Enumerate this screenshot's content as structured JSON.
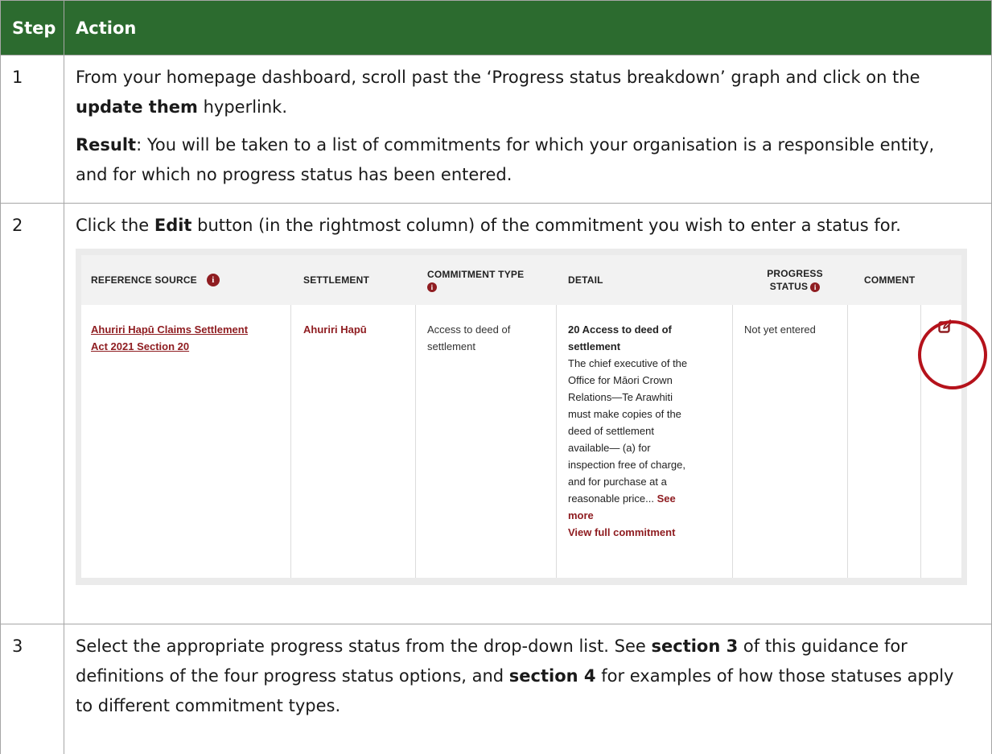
{
  "table": {
    "headers": [
      "Step",
      "Action"
    ],
    "rows": [
      {
        "step": "1",
        "p1_a": "From your homepage dashboard, scroll past the ‘Progress status breakdown’ graph and click on the ",
        "p1_b": "update them",
        "p1_c": " hyperlink.",
        "p2_a": "Result",
        "p2_b": ": You will be taken to a list of commitments for which your organisation is a responsible entity, and for which no progress status has been entered."
      },
      {
        "step": "2",
        "p1_a": "Click the ",
        "p1_b": "Edit",
        "p1_c": " button (in the rightmost column) of the commitment you wish to enter a status for."
      },
      {
        "step": "3",
        "p1_a": "Select the appropriate progress status from the drop-down list. See ",
        "p1_b": "section 3",
        "p1_c": " of this guidance for definitions of the four progress status options, and ",
        "p1_d": "section 4",
        "p1_e": " for examples of how those statuses apply to different commitment types."
      }
    ]
  },
  "screenshot": {
    "headers": {
      "reference_source": "REFERENCE SOURCE",
      "settlement": "SETTLEMENT",
      "commitment_type": "COMMITMENT TYPE",
      "detail": "DETAIL",
      "progress_status_1": "PROGRESS",
      "progress_status_2": "STATUS",
      "comment": "COMMENT"
    },
    "row": {
      "reference_link_1": "Ahuriri Hapū Claims Settlement",
      "reference_link_2": "Act 2021 Section 20",
      "settlement": "Ahuriri Hapū",
      "commitment_type_1": "Access to deed of",
      "commitment_type_2": "settlement",
      "detail_title_1": "20 Access to deed of",
      "detail_title_2": "settlement",
      "detail_body": [
        "The chief executive of the",
        "Office for Māori Crown",
        "Relations—Te Arawhiti",
        "must make copies of the",
        "deed of settlement",
        "available— (a) for",
        "inspection free of charge,",
        "and for purchase at a"
      ],
      "detail_last": "reasonable price... ",
      "see": "See",
      "more": "more",
      "view_full": "View full commitment",
      "progress_status": "Not yet entered",
      "comment": ""
    },
    "icons": {
      "info": "info-circle-icon",
      "edit": "edit-icon"
    },
    "colors": {
      "accent_red": "#8f1d21",
      "header_green": "#2c6b2f",
      "highlight_circle": "#b5121b"
    }
  }
}
